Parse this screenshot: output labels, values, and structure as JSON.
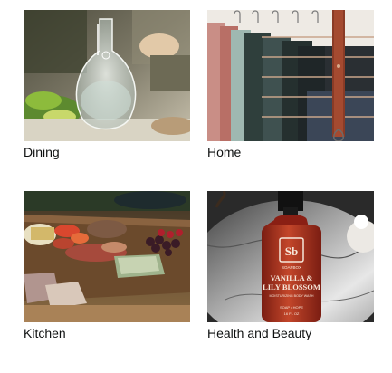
{
  "categories": [
    {
      "label": "Dining",
      "image": "glass-carafe-dinner-table-photo"
    },
    {
      "label": "Home",
      "image": "hanging-blankets-leather-rack-photo"
    },
    {
      "label": "Kitchen",
      "image": "charcuterie-board-photo"
    },
    {
      "label": "Health and Beauty",
      "image": "vanilla-lily-blossom-bottle-photo"
    }
  ],
  "product": {
    "brand_mark": "Sb",
    "brand_name": "SOAPBOX",
    "title_line1": "VANILLA &",
    "title_line2": "LILY BLOSSOM",
    "subtitle": "MOISTURIZING BODY WASH",
    "type": "SOAP • HOPE",
    "volume": "16 FL OZ"
  }
}
